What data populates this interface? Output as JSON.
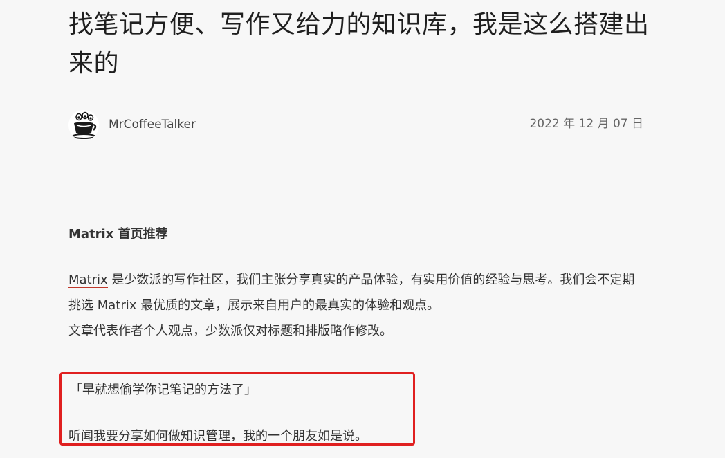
{
  "article": {
    "title": "找笔记方便、写作又给力的知识库，我是这么搭建出来的",
    "author": "MrCoffeeTalker",
    "date": "2022 年 12 月 07 日"
  },
  "recommendation": {
    "heading": "Matrix 首页推荐",
    "link_text": "Matrix",
    "line1_rest": " 是少数派的写作社区，我们主张分享真实的产品体验，有实用价值的经验与思考。我们会不定期挑选 Matrix 最优质的文章，展示来自用户的最真实的体验和观点。",
    "line2": "文章代表作者个人观点，少数派仅对标题和排版略作修改。"
  },
  "body": {
    "quote": "「早就想偷学你记笔记的方法了」",
    "paragraph": "听闻我要分享如何做知识管理，我的一个朋友如是说。"
  },
  "colors": {
    "background": "#f7f7f7",
    "link_underline": "#c0392b",
    "highlight_border": "#e02020"
  }
}
